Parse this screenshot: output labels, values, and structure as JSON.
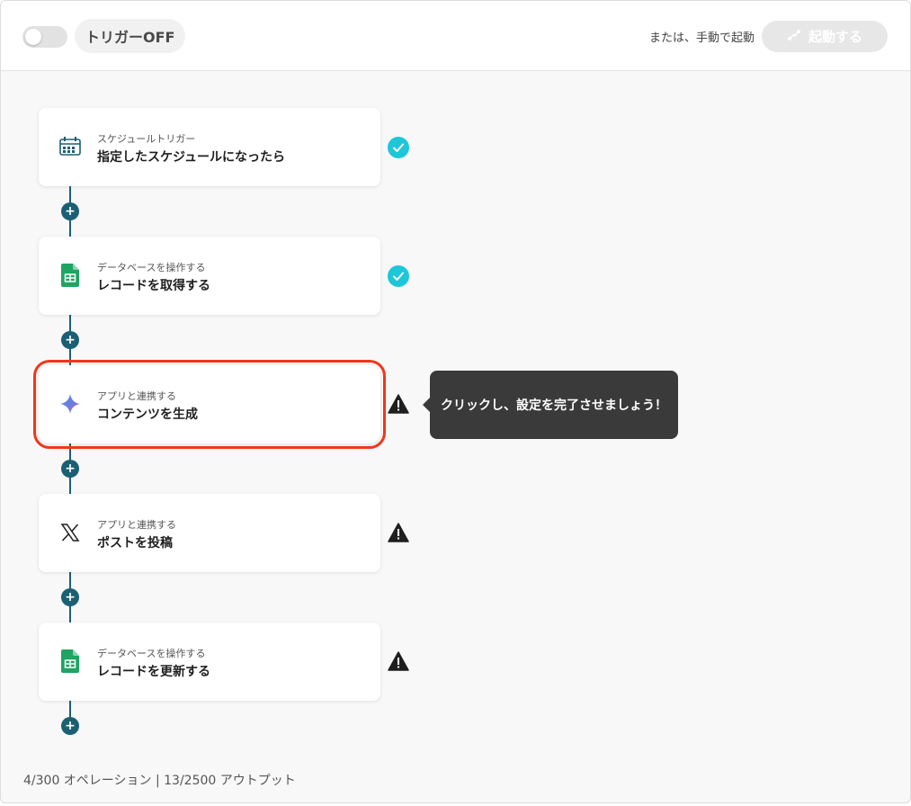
{
  "header": {
    "trigger_label": "トリガーOFF",
    "manual_text": "または、手動で起動",
    "start_button_label": "起動する",
    "toggle_state": "off"
  },
  "steps": [
    {
      "subtitle": "スケジュールトリガー",
      "title": "指定したスケジュールになったら",
      "icon": "calendar-icon",
      "status": "complete"
    },
    {
      "subtitle": "データベースを操作する",
      "title": "レコードを取得する",
      "icon": "sheets-icon",
      "status": "complete"
    },
    {
      "subtitle": "アプリと連携する",
      "title": "コンテンツを生成",
      "icon": "gemini-sparkle-icon",
      "status": "warning"
    },
    {
      "subtitle": "アプリと連携する",
      "title": "ポストを投稿",
      "icon": "x-logo-icon",
      "status": "warning"
    },
    {
      "subtitle": "データベースを操作する",
      "title": "レコードを更新する",
      "icon": "sheets-icon",
      "status": "warning"
    }
  ],
  "tooltip": {
    "text": "クリックし、設定を完了させましょう！"
  },
  "footer": {
    "usage": "4/300 オペレーション | 13/2500 アウトプット"
  },
  "colors": {
    "accent_teal": "#1b5f73",
    "check_cyan": "#1ec6d9",
    "highlight_red": "#f2361a",
    "sheets_green": "#1fa463"
  }
}
